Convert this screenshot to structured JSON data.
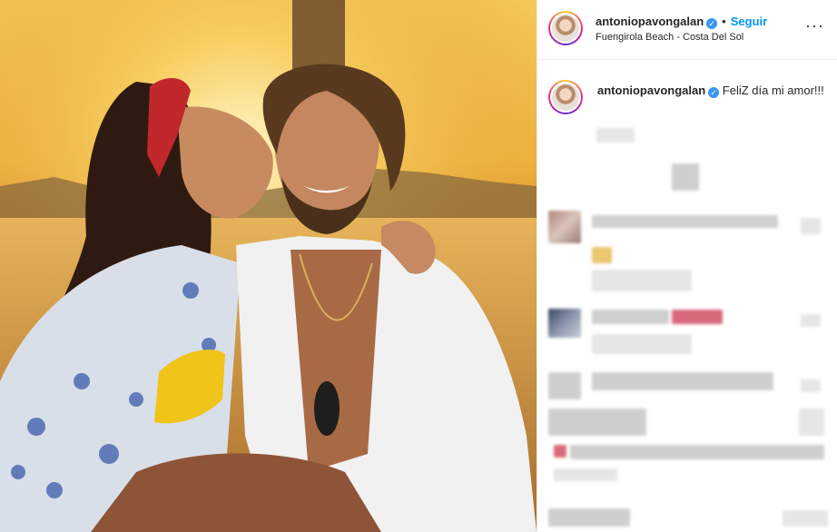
{
  "post": {
    "username": "antoniopavongalan",
    "follow_label": "Seguir",
    "location": "Fuengirola Beach - Costa Del Sol",
    "more_label": "···",
    "caption_user": "antoniopavongalan",
    "caption_text": "FeliZ día mi amor!!!",
    "verified_symbol": "✓",
    "separator": "•"
  },
  "photo": {
    "description_colors": {
      "sky": "#f0b843",
      "sea": "#c58b3a",
      "shirt": "#f2f2f2"
    }
  },
  "colors": {
    "accent": "#0095f6",
    "verified": "#3897f0"
  }
}
